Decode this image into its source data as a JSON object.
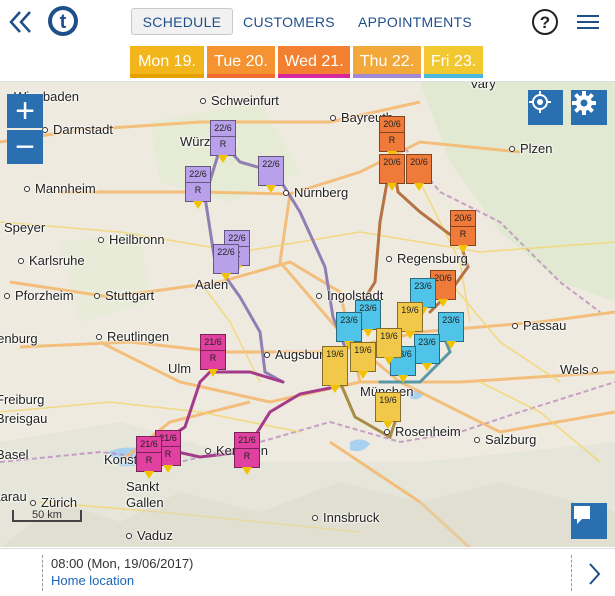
{
  "nav": {
    "tabs": [
      "SCHEDULE",
      "CUSTOMERS",
      "APPOINTMENTS"
    ],
    "active_tab": "SCHEDULE",
    "accent": "#1f4f8a"
  },
  "days": [
    {
      "label": "Mon 19.",
      "color": "#f2b51c",
      "underline": "#e6a100"
    },
    {
      "label": "Tue 20.",
      "color": "#f49330",
      "underline": "#ef6b2e"
    },
    {
      "label": "Wed 21.",
      "color": "#f28030",
      "underline": "#d6279b"
    },
    {
      "label": "Thu 22.",
      "color": "#f2a93a",
      "underline": "#a08ad6"
    },
    {
      "label": "Fri 23.",
      "color": "#f2c830",
      "underline": "#49b8dc"
    }
  ],
  "map": {
    "zoom_in_label": "+",
    "zoom_out_label": "−",
    "scale_label": "50 km",
    "cities": [
      "Wiesbaden",
      "Schweinfurt",
      "Bayreuth",
      "Darmstadt",
      "Würzburg",
      "Plzen",
      "Mannheim",
      "Nürnberg",
      "Speyer",
      "Heilbronn",
      "Karlsruhe",
      "Regensburg",
      "Pforzheim",
      "Stuttgart",
      "Aalen",
      "Ingolstadt",
      "Passau",
      "Reutlingen",
      "Ulm",
      "Augsburg",
      "München",
      "Wels",
      "Rosenheim",
      "Salzburg",
      "Kempten",
      "Konstanz",
      "Sankt Gallen",
      "Zürich",
      "Innsbruck",
      "Vaduz",
      "Vary",
      "Offenburg",
      "Freiburg",
      "Breisgau",
      "Basel",
      "Aarau"
    ]
  },
  "markers": {
    "mon": "19/6",
    "tue": "20/6",
    "wed": "21/6",
    "thu": "22/6",
    "fri": "23/6",
    "r": "R"
  },
  "bottom": {
    "time": "08:00 (Mon, 19/06/2017)",
    "location": "Home location"
  },
  "colors": {
    "mon": "#f2c84b",
    "tue": "#f07a3a",
    "wed": "#e0409f",
    "thu": "#b9a0ea",
    "fri": "#4fc3e8",
    "control": "#2a6fb0"
  }
}
